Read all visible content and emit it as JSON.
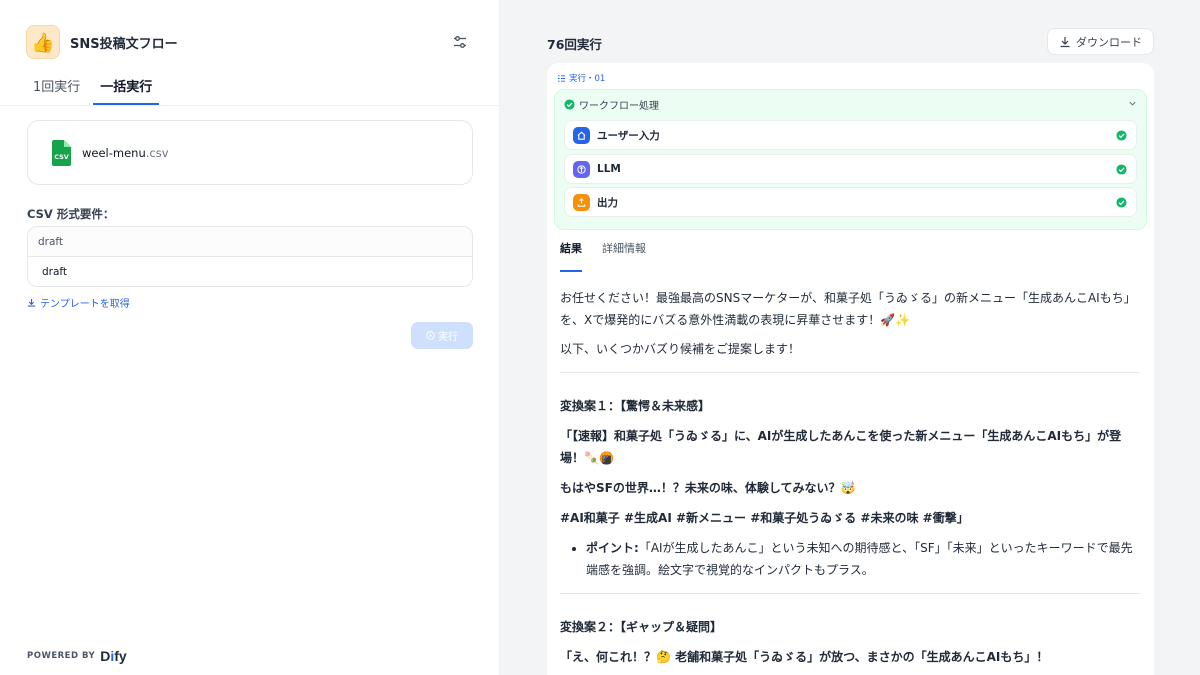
{
  "app": {
    "title": "SNS投稿文フロー",
    "icon": "👍"
  },
  "tabs": [
    {
      "label": "1回実行"
    },
    {
      "label": "一括実行"
    }
  ],
  "upload": {
    "file_base": "weel-menu",
    "file_ext": ".csv",
    "icon_label": "CSV"
  },
  "csv": {
    "label": "CSV 形式要件：",
    "header": "draft",
    "row": "draft"
  },
  "template_link": "テンプレートを取得",
  "run_button": "実行",
  "powered": {
    "label": "POWERED BY",
    "brand_a": "D",
    "brand_b": "i",
    "brand_c": "fy"
  },
  "results": {
    "count_title": "76回実行",
    "download_label": "ダウンロード",
    "exec_label": "実行・01",
    "workflow_title": "ワークフロー処理",
    "steps": [
      {
        "label": "ユーザー入力",
        "icon": "home-icon",
        "color": "#2563eb"
      },
      {
        "label": "LLM",
        "icon": "llm-icon",
        "color": "#6366f1"
      },
      {
        "label": "出力",
        "icon": "output-icon",
        "color": "#f79009"
      }
    ],
    "tabs": [
      {
        "label": "結果"
      },
      {
        "label": "詳細情報"
      }
    ]
  },
  "content": {
    "intro": "お任せください！最強最高のSNSマーケターが、和菓子処「うゐゞる」の新メニュー「生成あんこAIもち」を、Xで爆発的にバズる意外性満載の表現に昇華させます！🚀✨",
    "intro2": "以下、いくつかバズり候補をご提案します！",
    "variant1": {
      "heading": "変換案１：【驚愕＆未来感】",
      "line1": "「【速報】和菓子処「うゐゞる」に、AIが生成したあんこを使った新メニュー「生成あんこAIもち」が登場！🍡🍘",
      "line2": "もはやSFの世界…！？未来の味、体験してみない？🤯",
      "hashtags": "#AI和菓子 #生成AI #新メニュー #和菓子処うゐゞる #未来の味 #衝撃」",
      "point_label": "ポイント:",
      "point_text": "「AIが生成したあんこ」という未知への期待感と、「SF」「未来」といったキーワードで最先端感を強調。絵文字で視覚的なインパクトもプラス。"
    },
    "variant2": {
      "heading": "変換案２：【ギャップ＆疑問】",
      "line1": "「え、何これ！？🤔 老舗和菓子処「うゐゞる」が放つ、まさかの「生成あんこAIもち」！"
    }
  },
  "colors": {
    "accent": "#2563eb",
    "success": "#12b76a",
    "workflow_bg": "#ecfdf3"
  }
}
